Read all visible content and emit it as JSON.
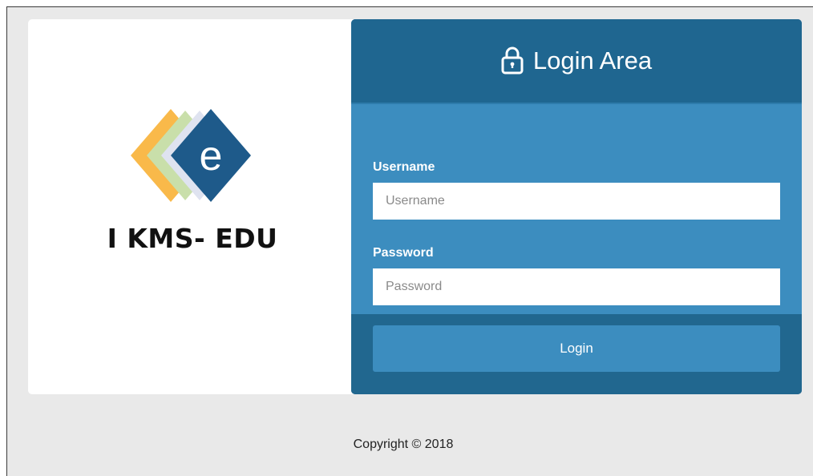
{
  "brand": {
    "name": "I KMS- EDU",
    "logo_letter": "e",
    "logo_icon": "layered-diamond-e-logo"
  },
  "login": {
    "title": "Login Area",
    "title_icon": "lock-icon",
    "username_label": "Username",
    "username_placeholder": "Username",
    "username_value": "",
    "password_label": "Password",
    "password_placeholder": "Password",
    "password_value": "",
    "submit_label": "Login"
  },
  "footer": {
    "copyright": "Copyright © 2018"
  },
  "colors": {
    "page_bg": "#e9e9e9",
    "header_bg": "#1f6690",
    "body_bg": "#3c8dbf",
    "footer_bg": "#21678f",
    "button_bg": "#3c8dbf",
    "logo_navy": "#1e5a8a",
    "logo_yellow": "#f9b94a",
    "logo_green": "#c9dfaa",
    "logo_lavender": "#dfe3f0"
  }
}
